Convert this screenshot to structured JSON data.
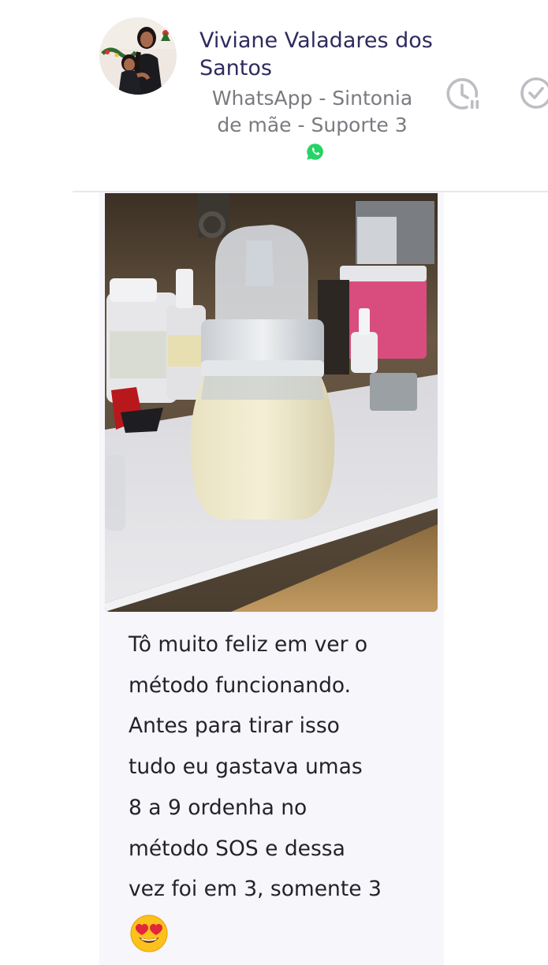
{
  "header": {
    "contact_name": "Viviane Valadares dos Santos",
    "channel_label": "WhatsApp - Sintonia de mãe - Suporte 3",
    "icons": [
      "avatar-photo",
      "whatsapp-icon",
      "snooze-clock-icon",
      "check-circle-icon"
    ]
  },
  "message": {
    "text": "Tô muito feliz em ver o\nmétodo funcionando.\nAntes para tirar isso\ntudo eu gastava umas\n8 a 9 ordenha no\nmétodo SOS e dessa\nvez foi em 3, somente 3",
    "emoji": "smiling-face-with-heart-eyes",
    "image": "baby-bottle-with-breast-milk-photo"
  },
  "colors": {
    "name": "#2f2b5e",
    "channel": "#7a7a80",
    "icons": "#bdbdc4",
    "bubble_bg": "#f6f6fb",
    "whatsapp": "#25d366"
  }
}
